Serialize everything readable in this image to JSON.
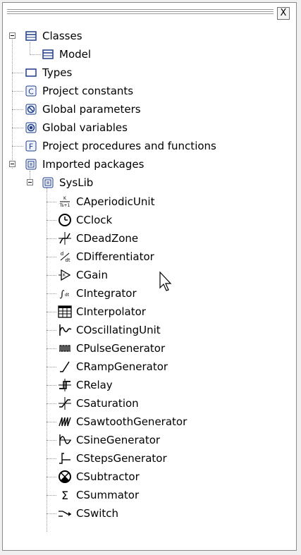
{
  "window": {
    "close_glyph": "X"
  },
  "tree": {
    "classes": {
      "label": "Classes",
      "icon": "class-icon"
    },
    "model": {
      "label": "Model",
      "icon": "class-icon"
    },
    "types": {
      "label": "Types",
      "icon": "type-icon"
    },
    "project_constants": {
      "label": "Project constants",
      "icon": "constant-icon"
    },
    "global_parameters": {
      "label": "Global parameters",
      "icon": "parameter-icon"
    },
    "global_variables": {
      "label": "Global variables",
      "icon": "variable-icon"
    },
    "project_procedures": {
      "label": "Project procedures and functions",
      "icon": "function-icon"
    },
    "imported_packages": {
      "label": "Imported packages",
      "icon": "package-icon"
    },
    "syslib": {
      "label": "SysLib",
      "icon": "package-icon"
    },
    "syslib_items": [
      {
        "label": "CAperiodicUnit",
        "icon": "aperiodic-unit-icon"
      },
      {
        "label": "CClock",
        "icon": "clock-icon"
      },
      {
        "label": "CDeadZone",
        "icon": "dead-zone-icon"
      },
      {
        "label": "CDifferentiator",
        "icon": "differentiator-icon"
      },
      {
        "label": "CGain",
        "icon": "gain-icon"
      },
      {
        "label": "CIntegrator",
        "icon": "integrator-icon"
      },
      {
        "label": "CInterpolator",
        "icon": "interpolator-icon"
      },
      {
        "label": "COscillatingUnit",
        "icon": "oscillating-unit-icon"
      },
      {
        "label": "CPulseGenerator",
        "icon": "pulse-generator-icon"
      },
      {
        "label": "CRampGenerator",
        "icon": "ramp-generator-icon"
      },
      {
        "label": "CRelay",
        "icon": "relay-icon"
      },
      {
        "label": "CSaturation",
        "icon": "saturation-icon"
      },
      {
        "label": "CSawtoothGenerator",
        "icon": "sawtooth-generator-icon"
      },
      {
        "label": "CSineGenerator",
        "icon": "sine-generator-icon"
      },
      {
        "label": "CStepsGenerator",
        "icon": "steps-generator-icon"
      },
      {
        "label": "CSubtractor",
        "icon": "subtractor-icon"
      },
      {
        "label": "CSummator",
        "icon": "summator-icon"
      },
      {
        "label": "CSwitch",
        "icon": "switch-icon"
      }
    ]
  },
  "colors": {
    "icon_blue": "#1f3c88",
    "line_gray": "#9a9a9a"
  }
}
